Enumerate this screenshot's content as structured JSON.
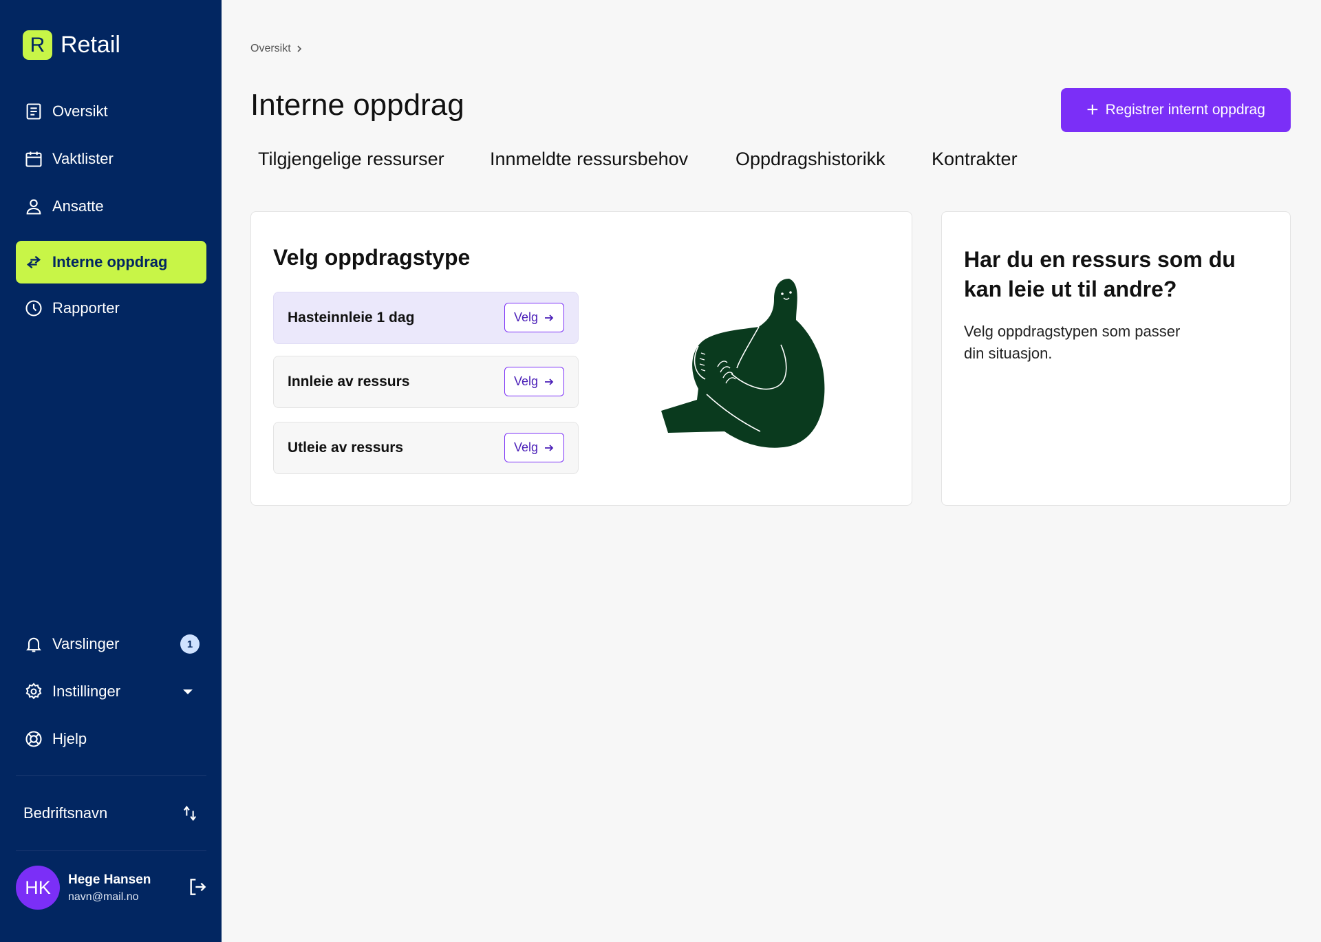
{
  "app": {
    "logo_letter": "R",
    "name": "Retail"
  },
  "sidebar": {
    "items": [
      {
        "label": "Oversikt",
        "icon": "document-icon"
      },
      {
        "label": "Vaktlister",
        "icon": "calendar-icon"
      },
      {
        "label": "Ansatte",
        "icon": "person-icon"
      },
      {
        "label": "Interne oppdrag",
        "icon": "swap-arrows-icon",
        "active": true
      },
      {
        "label": "Rapporter",
        "icon": "clock-icon"
      }
    ],
    "bottom_items": [
      {
        "label": "Varslinger",
        "icon": "bell-icon",
        "badge": "1"
      },
      {
        "label": "Instillinger",
        "icon": "gear-icon"
      },
      {
        "label": "Hjelp",
        "icon": "lifebuoy-icon"
      }
    ],
    "company": "Bedriftsnavn",
    "user": {
      "initials": "HK",
      "name": "Hege Hansen",
      "email": "navn@mail.no"
    }
  },
  "breadcrumb": {
    "label": "Oversikt"
  },
  "page": {
    "title": "Interne oppdrag",
    "primary_button": "Registrer internt oppdrag",
    "tabs": [
      "Tilgjengelige ressurser",
      "Innmeldte ressursbehov",
      "Oppdragshistorikk",
      "Kontrakter"
    ]
  },
  "main_card": {
    "title": "Velg oppdragstype",
    "options": [
      {
        "label": "Hasteinnleie 1 dag",
        "button": "Velg"
      },
      {
        "label": "Innleie av ressurs",
        "button": "Velg"
      },
      {
        "label": "Utleie av ressurs",
        "button": "Velg"
      }
    ]
  },
  "side_card": {
    "title": "Har du en ressurs som du kan leie ut til andre?",
    "text": "Velg oppdragstypen som passer din situasjon."
  },
  "colors": {
    "sidebar_bg": "#022661",
    "accent_lime": "#c8f547",
    "primary_purple": "#7b2ff7",
    "option_highlight": "#ebe8fb",
    "illustration_green": "#0a3a1e"
  }
}
